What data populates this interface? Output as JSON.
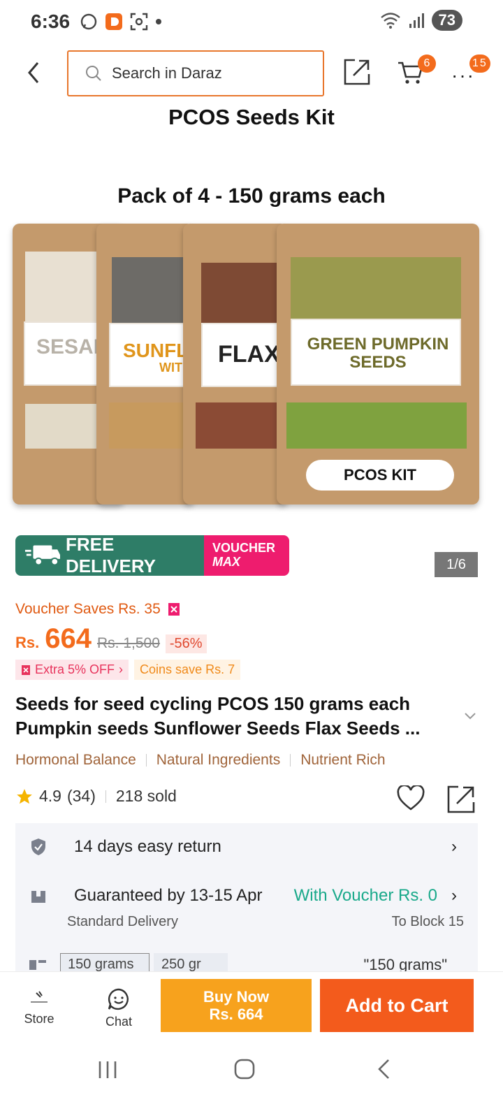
{
  "status": {
    "time": "6:36",
    "battery": "73"
  },
  "header": {
    "search_placeholder": "Search in Daraz",
    "cart_count": "6",
    "more_count": "15"
  },
  "hero": {
    "title": "PCOS Seeds Kit",
    "subtitle": "Pack of 4  -  150 grams each",
    "bags": [
      "SESAM",
      "SUNFLO",
      "FLAX",
      "GREEN PUMPKIN SEEDS"
    ],
    "bag_sub": "WITHO",
    "pill": "PCOS KIT",
    "counter": "1/6"
  },
  "banner": {
    "free_tag": "FREE",
    "free_delivery": "FREE DELIVERY",
    "voucher": "VOUCHER",
    "max": "MAX"
  },
  "pricing": {
    "voucher_saves": "Voucher Saves Rs. 35",
    "currency": "Rs.",
    "price": "664",
    "original": "Rs. 1,500",
    "discount": "-56%",
    "extra_off": "Extra 5% OFF",
    "coins": "Coins save Rs. 7"
  },
  "product": {
    "title": "Seeds for seed cycling PCOS 150 grams each Pumpkin seeds Sunflower Seeds Flax Seeds ...",
    "tags": [
      "Hormonal Balance",
      "Natural Ingredients",
      "Nutrient Rich"
    ],
    "rating": "4.9",
    "reviews": "(34)",
    "sold": "218 sold"
  },
  "service": {
    "return": "14 days easy return",
    "guarantee": "Guaranteed by 13-15 Apr",
    "voucher_note": "With Voucher Rs. 0",
    "delivery_type": "Standard Delivery",
    "location": "To Block 15",
    "variant1": "150 grams",
    "variant2": "250 gr",
    "selected_variant": "\"150 grams\""
  },
  "bottom": {
    "store": "Store",
    "chat": "Chat",
    "buy_now": "Buy Now",
    "buy_price": "Rs. 664",
    "add_to_cart": "Add to Cart"
  },
  "colors": {
    "accent": "#f36b1c",
    "buy_now": "#f7a21d",
    "delivery_green": "#2e7d67",
    "voucher_pink": "#ee1c6e"
  }
}
